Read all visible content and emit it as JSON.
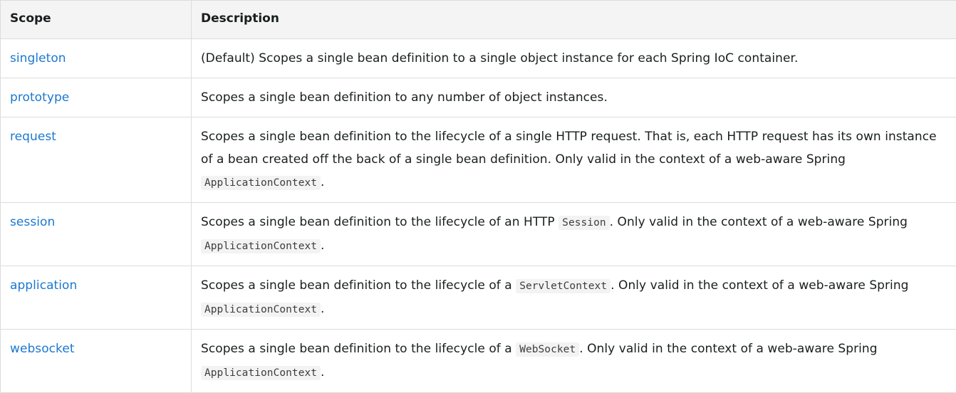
{
  "header": {
    "scope": "Scope",
    "description": "Description"
  },
  "rows": [
    {
      "scope": "singleton",
      "desc_before": "(Default) Scopes a single bean definition to a single object instance for each Spring IoC container."
    },
    {
      "scope": "prototype",
      "desc_before": "Scopes a single bean definition to any number of object instances."
    },
    {
      "scope": "request",
      "desc_before": "Scopes a single bean definition to the lifecycle of a single HTTP request. That is, each HTTP request has its own instance of a bean created off the back of a single bean definition. Only valid in the context of a web-aware Spring ",
      "code": "ApplicationContext",
      "desc_after": "."
    },
    {
      "scope": "session",
      "desc_before": "Scopes a single bean definition to the lifecycle of an HTTP ",
      "code": "Session",
      "desc_mid": ". Only valid in the context of a web-aware Spring ",
      "code2": "ApplicationContext",
      "desc_after": "."
    },
    {
      "scope": "application",
      "desc_before": "Scopes a single bean definition to the lifecycle of a ",
      "code": "ServletContext",
      "desc_mid": ". Only valid in the context of a web-aware Spring ",
      "code2": "ApplicationContext",
      "desc_after": "."
    },
    {
      "scope": "websocket",
      "desc_before": "Scopes a single bean definition to the lifecycle of a ",
      "code": "WebSocket",
      "desc_mid": ". Only valid in the context of a web-aware Spring ",
      "code2": "ApplicationContext",
      "desc_after": "."
    }
  ]
}
